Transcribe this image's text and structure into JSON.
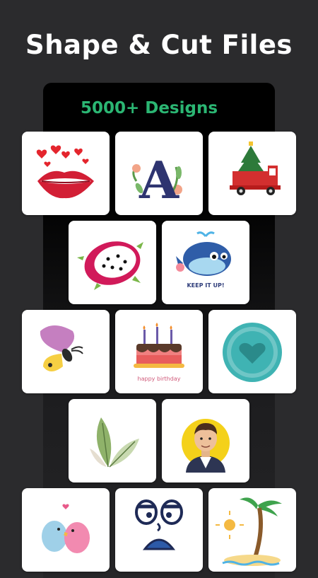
{
  "headline": "Shape & Cut Files",
  "subhead": "5000+ Designs",
  "art_text": {
    "whale_sticker": "KEEP IT UP!",
    "cake_caption": "happy birthday"
  },
  "designs": [
    {
      "id": "lips-hearts",
      "icon": "lips-hearts-icon"
    },
    {
      "id": "floral-letter-a",
      "icon": "floral-letter-a-icon",
      "letter": "A"
    },
    {
      "id": "christmas-truck",
      "icon": "christmas-truck-icon"
    },
    {
      "id": "dragon-fruit",
      "icon": "dragon-fruit-icon"
    },
    {
      "id": "whale-sticker",
      "icon": "whale-icon"
    },
    {
      "id": "butterfly",
      "icon": "butterfly-icon"
    },
    {
      "id": "birthday-cake",
      "icon": "birthday-cake-icon"
    },
    {
      "id": "heart-badge",
      "icon": "heart-badge-icon"
    },
    {
      "id": "leaves",
      "icon": "leaves-icon"
    },
    {
      "id": "man-avatar",
      "icon": "man-avatar-icon"
    },
    {
      "id": "love-birds",
      "icon": "love-birds-icon"
    },
    {
      "id": "cartoon-face",
      "icon": "cartoon-face-icon"
    },
    {
      "id": "palm-island",
      "icon": "palm-tree-icon"
    }
  ],
  "colors": {
    "background": "#2b2b2d",
    "panel": "#000000",
    "accent": "#2bb673",
    "card": "#ffffff"
  }
}
